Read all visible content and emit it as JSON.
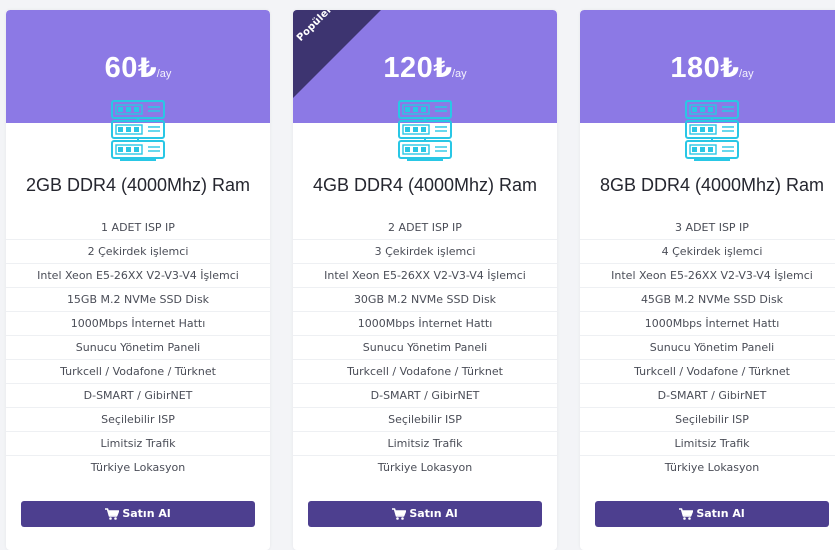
{
  "colors": {
    "accent": "#8c79e5",
    "ribbon": "#3d3470",
    "button": "#4d3f8f",
    "icon": "#29c7e5"
  },
  "currency_symbol": "₺",
  "period": "/ay",
  "ribbon_label": "Popüler",
  "buy_label": "Satın Al",
  "icons": {
    "plan": "server-icon",
    "button": "cart-icon"
  },
  "plans": [
    {
      "price": "60",
      "title": "2GB DDR4 (4000Mhz) Ram",
      "features": [
        "1 ADET ISP IP",
        "2 Çekirdek işlemci",
        "Intel Xeon E5-26XX V2-V3-V4 İşlemci",
        "15GB M.2 NVMe SSD Disk",
        "1000Mbps İnternet Hattı",
        "Sunucu Yönetim Paneli",
        "Turkcell / Vodafone / Türknet",
        "D-SMART / GibirNET",
        "Seçilebilir ISP",
        "Limitsiz Trafik",
        "Türkiye Lokasyon"
      ]
    },
    {
      "price": "120",
      "title": "4GB DDR4 (4000Mhz) Ram",
      "features": [
        "2 ADET ISP IP",
        "3 Çekirdek işlemci",
        "Intel Xeon E5-26XX V2-V3-V4 İşlemci",
        "30GB M.2 NVMe SSD Disk",
        "1000Mbps İnternet Hattı",
        "Sunucu Yönetim Paneli",
        "Turkcell / Vodafone / Türknet",
        "D-SMART / GibirNET",
        "Seçilebilir ISP",
        "Limitsiz Trafik",
        "Türkiye Lokasyon"
      ]
    },
    {
      "price": "180",
      "title": "8GB DDR4 (4000Mhz) Ram",
      "features": [
        "3 ADET ISP IP",
        "4 Çekirdek işlemci",
        "Intel Xeon E5-26XX V2-V3-V4 İşlemci",
        "45GB M.2 NVMe SSD Disk",
        "1000Mbps İnternet Hattı",
        "Sunucu Yönetim Paneli",
        "Turkcell / Vodafone / Türknet",
        "D-SMART / GibirNET",
        "Seçilebilir ISP",
        "Limitsiz Trafik",
        "Türkiye Lokasyon"
      ]
    }
  ]
}
